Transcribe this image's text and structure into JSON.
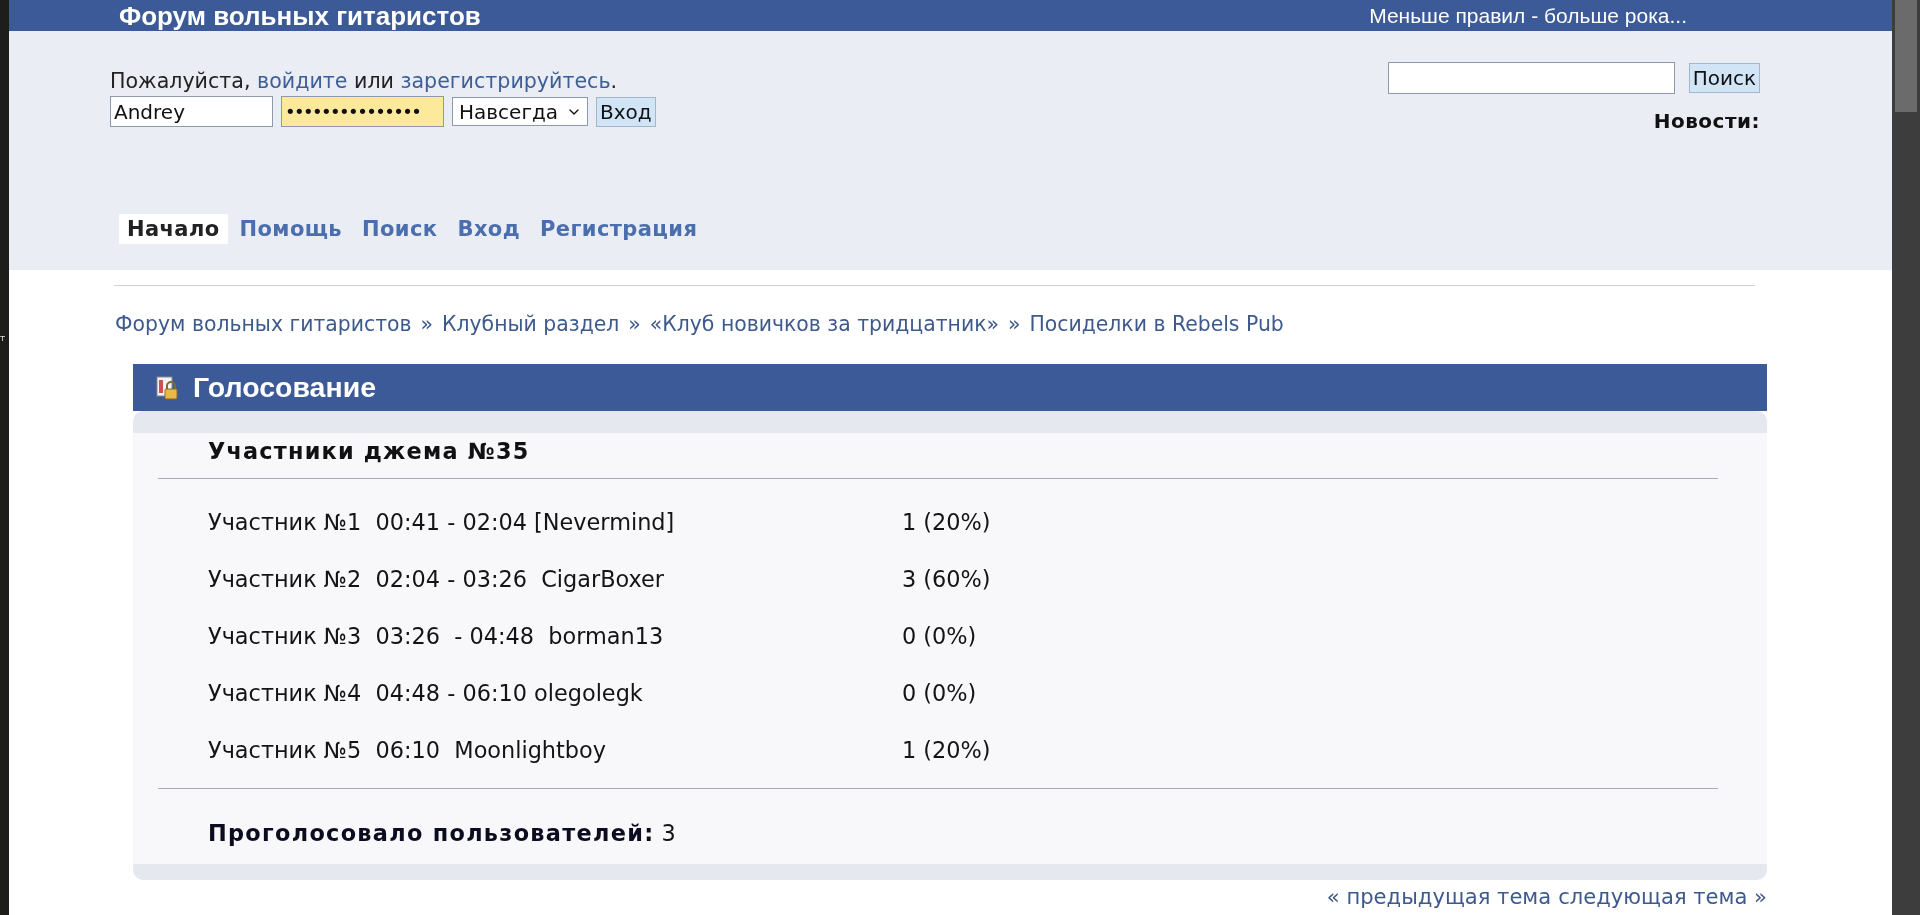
{
  "browser_edge": {
    "text": "т"
  },
  "header": {
    "title": "Форум вольных гитаристов",
    "slogan": "Меньше правил - больше рока..."
  },
  "login": {
    "prompt": [
      {
        "kind": "text",
        "text": "Пожалуйста, "
      },
      {
        "kind": "link",
        "text": "войдите"
      },
      {
        "kind": "text",
        "text": " или "
      },
      {
        "kind": "link",
        "text": "зарегистрируйтесь"
      },
      {
        "kind": "text",
        "text": "."
      }
    ],
    "username": "Andrey",
    "password": "•••••••••••••••",
    "duration": "Навсегда",
    "submit": "Вход"
  },
  "search": {
    "button": "Поиск"
  },
  "news": {
    "label": "Новости:"
  },
  "nav": [
    {
      "label": "Начало",
      "selected": true
    },
    {
      "label": "Помощь",
      "selected": false
    },
    {
      "label": "Поиск",
      "selected": false
    },
    {
      "label": "Вход",
      "selected": false
    },
    {
      "label": "Регистрация",
      "selected": false
    }
  ],
  "breadcrumb": {
    "items": [
      "Форум вольных гитаристов",
      "Клубный раздел",
      "«Клуб новичков за тридцатник»",
      "Посиделки в Rebels Pub"
    ],
    "separator": "»"
  },
  "poll": {
    "header": "Голосование",
    "question": "Участники джема №35",
    "options": [
      {
        "label": "Участник №1  00:41 - 02:04 [Nevermind]",
        "result": "1 (20%)"
      },
      {
        "label": "Участник №2  02:04 - 03:26  CigarBoxer",
        "result": "3 (60%)"
      },
      {
        "label": "Участник №3  03:26  - 04:48  borman13",
        "result": "0 (0%)"
      },
      {
        "label": "Участник №4  04:48 - 06:10 olegolegk",
        "result": "0 (0%)"
      },
      {
        "label": "Участник №5  06:10  Moonlightboy",
        "result": "1 (20%)"
      }
    ],
    "total": "**Проголосовало пользователей:** 3"
  },
  "pager": {
    "previous": "« предыдущая тема",
    "next": "следующая тема »"
  }
}
